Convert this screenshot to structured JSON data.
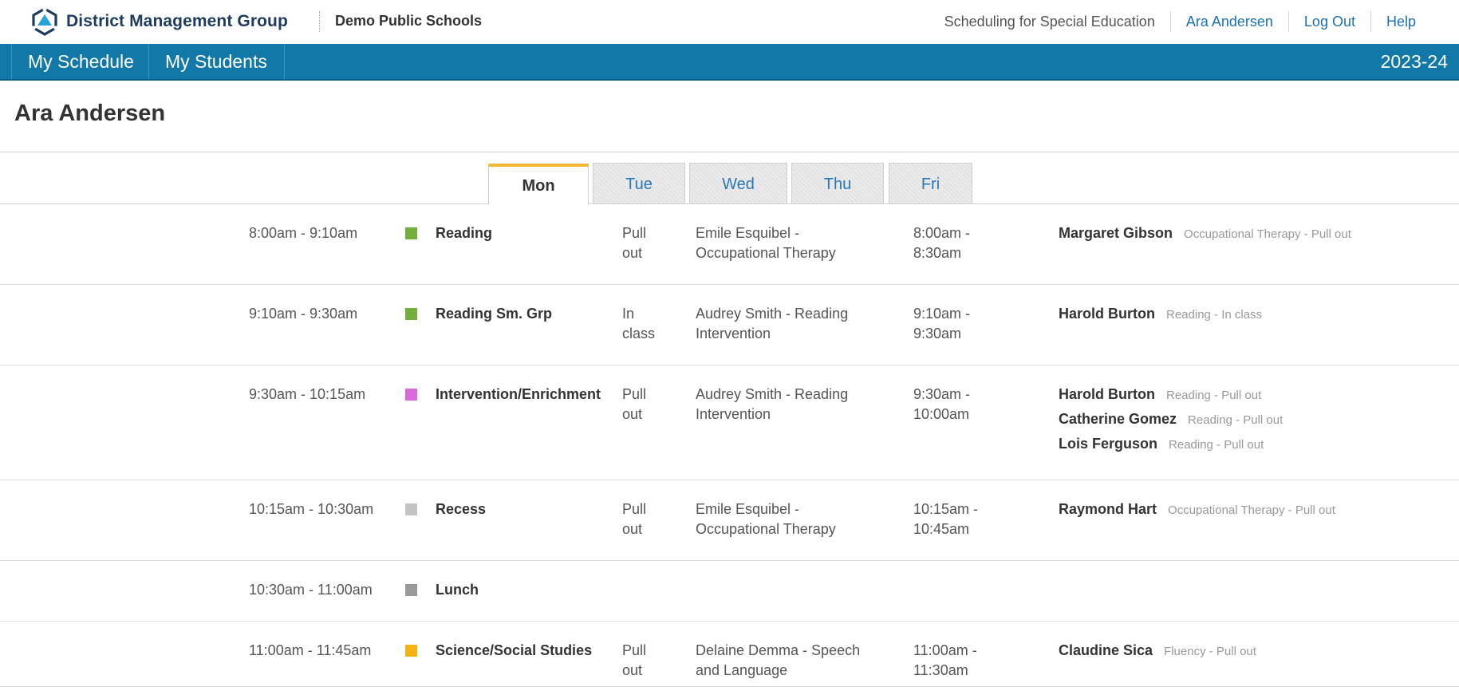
{
  "header": {
    "logo_text": "District Management Group",
    "district": "Demo Public Schools",
    "app_name": "Scheduling for Special Education",
    "user": "Ara Andersen",
    "logout": "Log Out",
    "help": "Help"
  },
  "nav": {
    "items": [
      "My Schedule",
      "My Students"
    ],
    "year": "2023-24"
  },
  "page_title": "Ara Andersen",
  "tabs": [
    "Mon",
    "Tue",
    "Wed",
    "Thu",
    "Fri"
  ],
  "active_tab": "Mon",
  "colors": {
    "nav_bg": "#1278a8",
    "accent_tab": "#f2b632",
    "link": "#1a72b2",
    "reading": "#74ae3c",
    "intervention": "#d96ad9",
    "recess": "#c4c4c4",
    "lunch": "#9a9a9a",
    "science": "#f5b313"
  },
  "rows": [
    {
      "time": "8:00am - 9:10am",
      "color": "#74ae3c",
      "subject": "Reading",
      "mode": "Pull out",
      "provider": "Emile Esquibel - Occupational Therapy",
      "service_time": "8:00am - 8:30am",
      "students": [
        {
          "name": "Margaret Gibson",
          "service": "Occupational Therapy - Pull out"
        }
      ]
    },
    {
      "time": "9:10am - 9:30am",
      "color": "#74ae3c",
      "subject": "Reading Sm. Grp",
      "mode": "In class",
      "provider": "Audrey Smith - Reading Intervention",
      "service_time": "9:10am - 9:30am",
      "students": [
        {
          "name": "Harold Burton",
          "service": "Reading - In class"
        }
      ]
    },
    {
      "time": "9:30am - 10:15am",
      "color": "#d96ad9",
      "subject": "Intervention/Enrichment",
      "mode": "Pull out",
      "provider": "Audrey Smith - Reading Intervention",
      "service_time": "9:30am - 10:00am",
      "students": [
        {
          "name": "Harold Burton",
          "service": "Reading - Pull out"
        },
        {
          "name": "Catherine Gomez",
          "service": "Reading - Pull out"
        },
        {
          "name": "Lois Ferguson",
          "service": "Reading - Pull out"
        }
      ]
    },
    {
      "time": "10:15am - 10:30am",
      "color": "#c4c4c4",
      "subject": "Recess",
      "mode": "Pull out",
      "provider": "Emile Esquibel - Occupational Therapy",
      "service_time": "10:15am - 10:45am",
      "students": [
        {
          "name": "Raymond Hart",
          "service": "Occupational Therapy - Pull out"
        }
      ]
    },
    {
      "time": "10:30am - 11:00am",
      "color": "#9a9a9a",
      "subject": "Lunch",
      "mode": "",
      "provider": "",
      "service_time": "",
      "students": []
    },
    {
      "time": "11:00am - 11:45am",
      "color": "#f5b313",
      "subject": "Science/Social Studies",
      "mode": "Pull out",
      "provider": "Delaine Demma - Speech and Language",
      "service_time": "11:00am - 11:30am",
      "students": [
        {
          "name": "Claudine Sica",
          "service": "Fluency - Pull out"
        }
      ]
    }
  ]
}
